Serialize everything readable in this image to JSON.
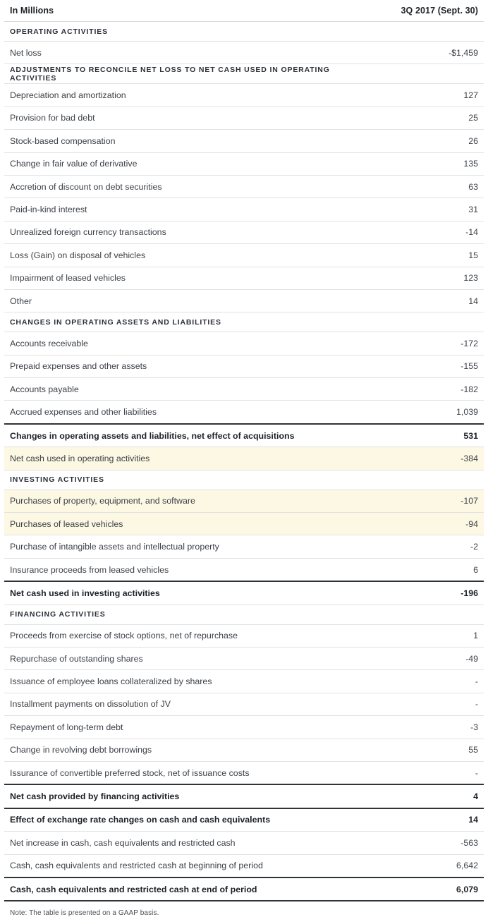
{
  "table": {
    "header": {
      "label": "In Millions",
      "value": "3Q 2017 (Sept. 30)"
    },
    "rows": [
      {
        "kind": "section",
        "label": "OPERATING ACTIVITIES",
        "value": ""
      },
      {
        "kind": "item",
        "label": "Net loss",
        "value": "-$1,459"
      },
      {
        "kind": "section",
        "label": "ADJUSTMENTS TO RECONCILE NET LOSS TO NET CASH USED IN OPERATING ACTIVITIES",
        "value": ""
      },
      {
        "kind": "item",
        "label": "Depreciation and amortization",
        "value": "127"
      },
      {
        "kind": "item",
        "label": "Provision for bad debt",
        "value": "25"
      },
      {
        "kind": "item",
        "label": "Stock-based compensation",
        "value": "26"
      },
      {
        "kind": "item",
        "label": "Change in fair value of derivative",
        "value": "135"
      },
      {
        "kind": "item",
        "label": "Accretion of discount on debt securities",
        "value": "63"
      },
      {
        "kind": "item",
        "label": "Paid-in-kind interest",
        "value": "31"
      },
      {
        "kind": "item",
        "label": "Unrealized foreign currency transactions",
        "value": "-14"
      },
      {
        "kind": "item",
        "label": "Loss (Gain) on disposal of vehicles",
        "value": "15"
      },
      {
        "kind": "item",
        "label": "Impairment of leased vehicles",
        "value": "123"
      },
      {
        "kind": "item",
        "label": "Other",
        "value": "14"
      },
      {
        "kind": "section",
        "label": "CHANGES IN OPERATING ASSETS AND LIABILITIES",
        "value": ""
      },
      {
        "kind": "item",
        "label": "Accounts receivable",
        "value": "-172"
      },
      {
        "kind": "item",
        "label": "Prepaid expenses and other assets",
        "value": "-155"
      },
      {
        "kind": "item",
        "label": "Accounts payable",
        "value": "-182"
      },
      {
        "kind": "item",
        "label": "Accrued expenses and other liabilities",
        "value": "1,039"
      },
      {
        "kind": "total",
        "label": "Changes in operating assets and liabilities, net effect of acquisitions",
        "value": "531"
      },
      {
        "kind": "item",
        "highlight": true,
        "label": "Net cash used in operating activities",
        "value": "-384"
      },
      {
        "kind": "section",
        "label": "INVESTING ACTIVITIES",
        "value": ""
      },
      {
        "kind": "item",
        "highlight": true,
        "label": "Purchases of property, equipment, and software",
        "value": "-107"
      },
      {
        "kind": "item",
        "highlight": true,
        "label": "Purchases of leased vehicles",
        "value": "-94"
      },
      {
        "kind": "item",
        "label": "Purchase of intangible assets and intellectual property",
        "value": "-2"
      },
      {
        "kind": "item",
        "label": "Insurance proceeds from leased vehicles",
        "value": "6"
      },
      {
        "kind": "total",
        "label": "Net cash used in investing activities",
        "value": "-196"
      },
      {
        "kind": "section",
        "label": "FINANCING ACTIVITIES",
        "value": ""
      },
      {
        "kind": "item",
        "label": "Proceeds from exercise of stock options, net of repurchase",
        "value": "1"
      },
      {
        "kind": "item",
        "label": "Repurchase of outstanding shares",
        "value": "-49"
      },
      {
        "kind": "item",
        "label": "Issuance of employee loans collateralized by shares",
        "value": "-"
      },
      {
        "kind": "item",
        "label": "Installment payments on dissolution of JV",
        "value": "-"
      },
      {
        "kind": "item",
        "label": "Repayment of long-term debt",
        "value": "-3"
      },
      {
        "kind": "item",
        "label": "Change in revolving debt borrowings",
        "value": "55"
      },
      {
        "kind": "item",
        "label": "Issurance of convertible preferred stock, net of issuance costs",
        "value": "-"
      },
      {
        "kind": "total",
        "label": "Net cash provided by financing activities",
        "value": "4"
      },
      {
        "kind": "total",
        "label": "Effect of exchange rate changes on cash and cash equivalents",
        "value": "14"
      },
      {
        "kind": "item",
        "label": "Net increase in cash, cash equivalents and restricted cash",
        "value": "-563"
      },
      {
        "kind": "item",
        "label": "Cash, cash equivalents and restricted cash at beginning of period",
        "value": "6,642"
      },
      {
        "kind": "total",
        "last": true,
        "label": "Cash, cash equivalents and restricted cash at end of period",
        "value": "6,079"
      }
    ]
  },
  "footnote": "Note: The table is presented on a GAAP basis.",
  "colors": {
    "highlight": "#fdf8e3",
    "rule_light": "#e2e2e2",
    "rule_dark": "#2f3439"
  }
}
